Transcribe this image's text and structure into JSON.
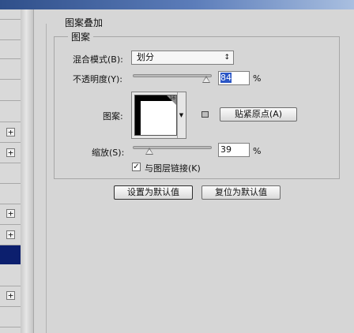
{
  "group": {
    "title": "图案叠加",
    "section": "图案"
  },
  "blend": {
    "label": "混合模式(B):",
    "value": "划分"
  },
  "opacity": {
    "label": "不透明度(Y):",
    "value": "84",
    "unit": "%",
    "level": 0.84
  },
  "pattern": {
    "label": "图案:",
    "badge": "16",
    "snap_button": "贴紧原点(A)"
  },
  "scale": {
    "label": "缩放(S):",
    "value": "39",
    "unit": "%",
    "level": 0.1
  },
  "link": {
    "label": "与图层链接(K)",
    "checked": true
  },
  "buttons": {
    "set_default": "设置为默认值",
    "reset_default": "复位为默认值"
  },
  "left_panel": {
    "expand_symbol": "+"
  }
}
